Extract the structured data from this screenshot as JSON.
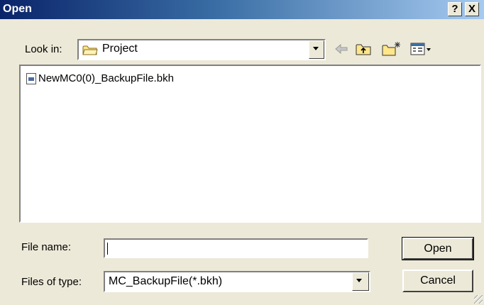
{
  "window": {
    "title": "Open"
  },
  "titlebar": {
    "help_label": "?",
    "close_label": "X"
  },
  "look_in": {
    "label": "Look in:",
    "value": "Project",
    "folder_icon": "folder-icon"
  },
  "toolbar": {
    "back_icon": "back-arrow-icon",
    "up_icon": "up-folder-icon",
    "new_folder_icon": "new-folder-icon",
    "view_icon": "view-menu-icon"
  },
  "files": [
    {
      "name": "NewMC0(0)_BackupFile.bkh",
      "icon": "backup-file-icon"
    }
  ],
  "file_name": {
    "label": "File name:",
    "value": ""
  },
  "files_of_type": {
    "label": "Files of type:",
    "value": "MC_BackupFile(*.bkh)"
  },
  "buttons": {
    "open": "Open",
    "cancel": "Cancel"
  },
  "colors": {
    "title_start": "#0a246a",
    "title_end": "#a6caf0",
    "face": "#ece9d8"
  }
}
